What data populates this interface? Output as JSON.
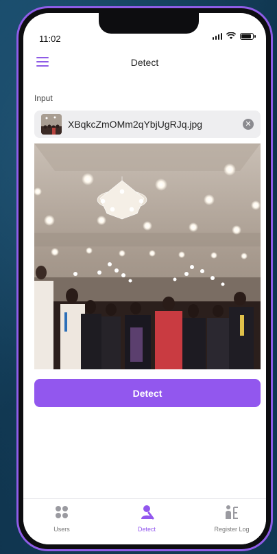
{
  "status_bar": {
    "time": "11:02"
  },
  "header": {
    "title": "Detect"
  },
  "input": {
    "label": "Input",
    "file_name": "XBqkcZmOMm2qYbjUgRJq.jpg"
  },
  "actions": {
    "detect_label": "Detect"
  },
  "tabs": [
    {
      "label": "Users",
      "icon": "grid-icon",
      "active": false
    },
    {
      "label": "Detect",
      "icon": "person-detect-icon",
      "active": true
    },
    {
      "label": "Register Log",
      "icon": "register-log-icon",
      "active": false
    }
  ],
  "colors": {
    "accent": "#9257ee",
    "phone_frame": "#8f5de8"
  }
}
